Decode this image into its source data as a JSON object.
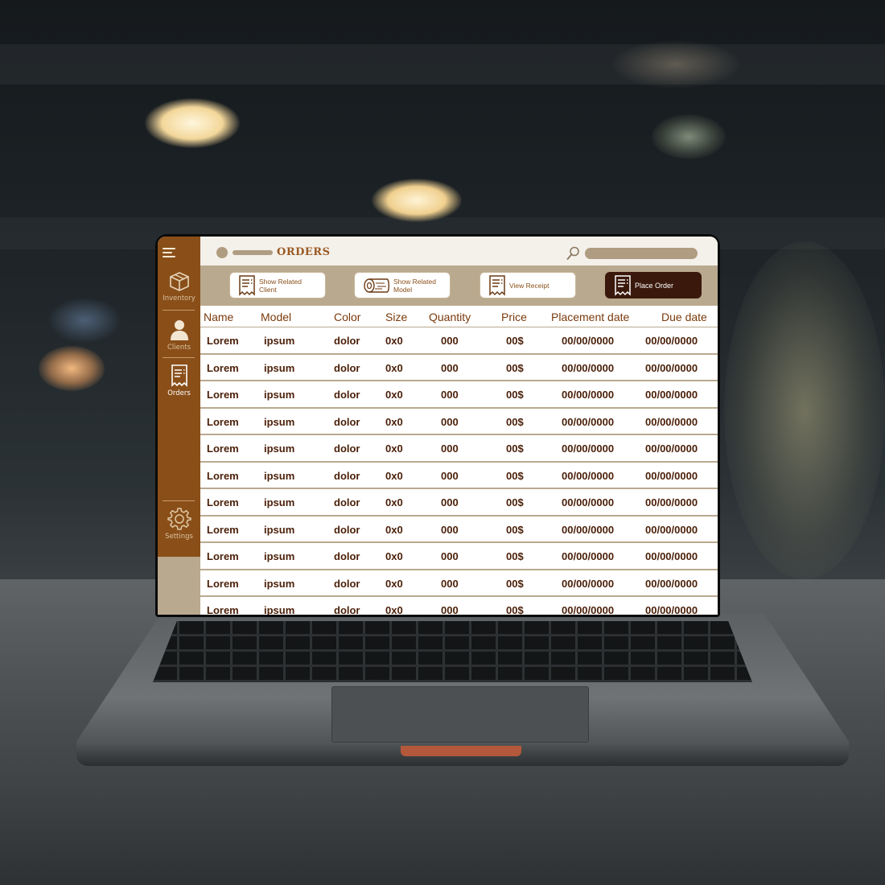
{
  "sidebar": {
    "items": [
      {
        "label": "Inventory",
        "icon": "box-icon"
      },
      {
        "label": "Clients",
        "icon": "person-icon"
      },
      {
        "label": "Orders",
        "icon": "receipt-icon",
        "active": true
      },
      {
        "label": "Settings",
        "icon": "gear-icon"
      }
    ]
  },
  "header": {
    "title": "ORDERS",
    "search_placeholder": ""
  },
  "actions": [
    {
      "label_line1": "Show Related",
      "label_line2": "Client",
      "icon": "receipt-icon"
    },
    {
      "label_line1": "Show Related",
      "label_line2": "Model",
      "icon": "wood-log-icon"
    },
    {
      "label_line1": "View Receipt",
      "label_line2": "",
      "icon": "receipt-icon"
    },
    {
      "label_line1": "Place Order",
      "label_line2": "",
      "icon": "receipt-icon",
      "primary": true
    }
  ],
  "table": {
    "columns": [
      "Name",
      "Model",
      "Color",
      "Size",
      "Quantity",
      "Price",
      "Placement date",
      "Due date"
    ],
    "rows": [
      [
        "Lorem",
        "ipsum",
        "dolor",
        "0x0",
        "000",
        "00$",
        "00/00/0000",
        "00/00/0000"
      ],
      [
        "Lorem",
        "ipsum",
        "dolor",
        "0x0",
        "000",
        "00$",
        "00/00/0000",
        "00/00/0000"
      ],
      [
        "Lorem",
        "ipsum",
        "dolor",
        "0x0",
        "000",
        "00$",
        "00/00/0000",
        "00/00/0000"
      ],
      [
        "Lorem",
        "ipsum",
        "dolor",
        "0x0",
        "000",
        "00$",
        "00/00/0000",
        "00/00/0000"
      ],
      [
        "Lorem",
        "ipsum",
        "dolor",
        "0x0",
        "000",
        "00$",
        "00/00/0000",
        "00/00/0000"
      ],
      [
        "Lorem",
        "ipsum",
        "dolor",
        "0x0",
        "000",
        "00$",
        "00/00/0000",
        "00/00/0000"
      ],
      [
        "Lorem",
        "ipsum",
        "dolor",
        "0x0",
        "000",
        "00$",
        "00/00/0000",
        "00/00/0000"
      ],
      [
        "Lorem",
        "ipsum",
        "dolor",
        "0x0",
        "000",
        "00$",
        "00/00/0000",
        "00/00/0000"
      ],
      [
        "Lorem",
        "ipsum",
        "dolor",
        "0x0",
        "000",
        "00$",
        "00/00/0000",
        "00/00/0000"
      ],
      [
        "Lorem",
        "ipsum",
        "dolor",
        "0x0",
        "000",
        "00$",
        "00/00/0000",
        "00/00/0000"
      ],
      [
        "Lorem",
        "ipsum",
        "dolor",
        "0x0",
        "000",
        "00$",
        "00/00/0000",
        "00/00/0000"
      ]
    ]
  },
  "colors": {
    "sidebar": "#8a4f19",
    "accent_beige": "#b9a98f",
    "title_brown": "#9a5a22",
    "primary_button": "#3a190c",
    "text_dark": "#4a1f08"
  }
}
